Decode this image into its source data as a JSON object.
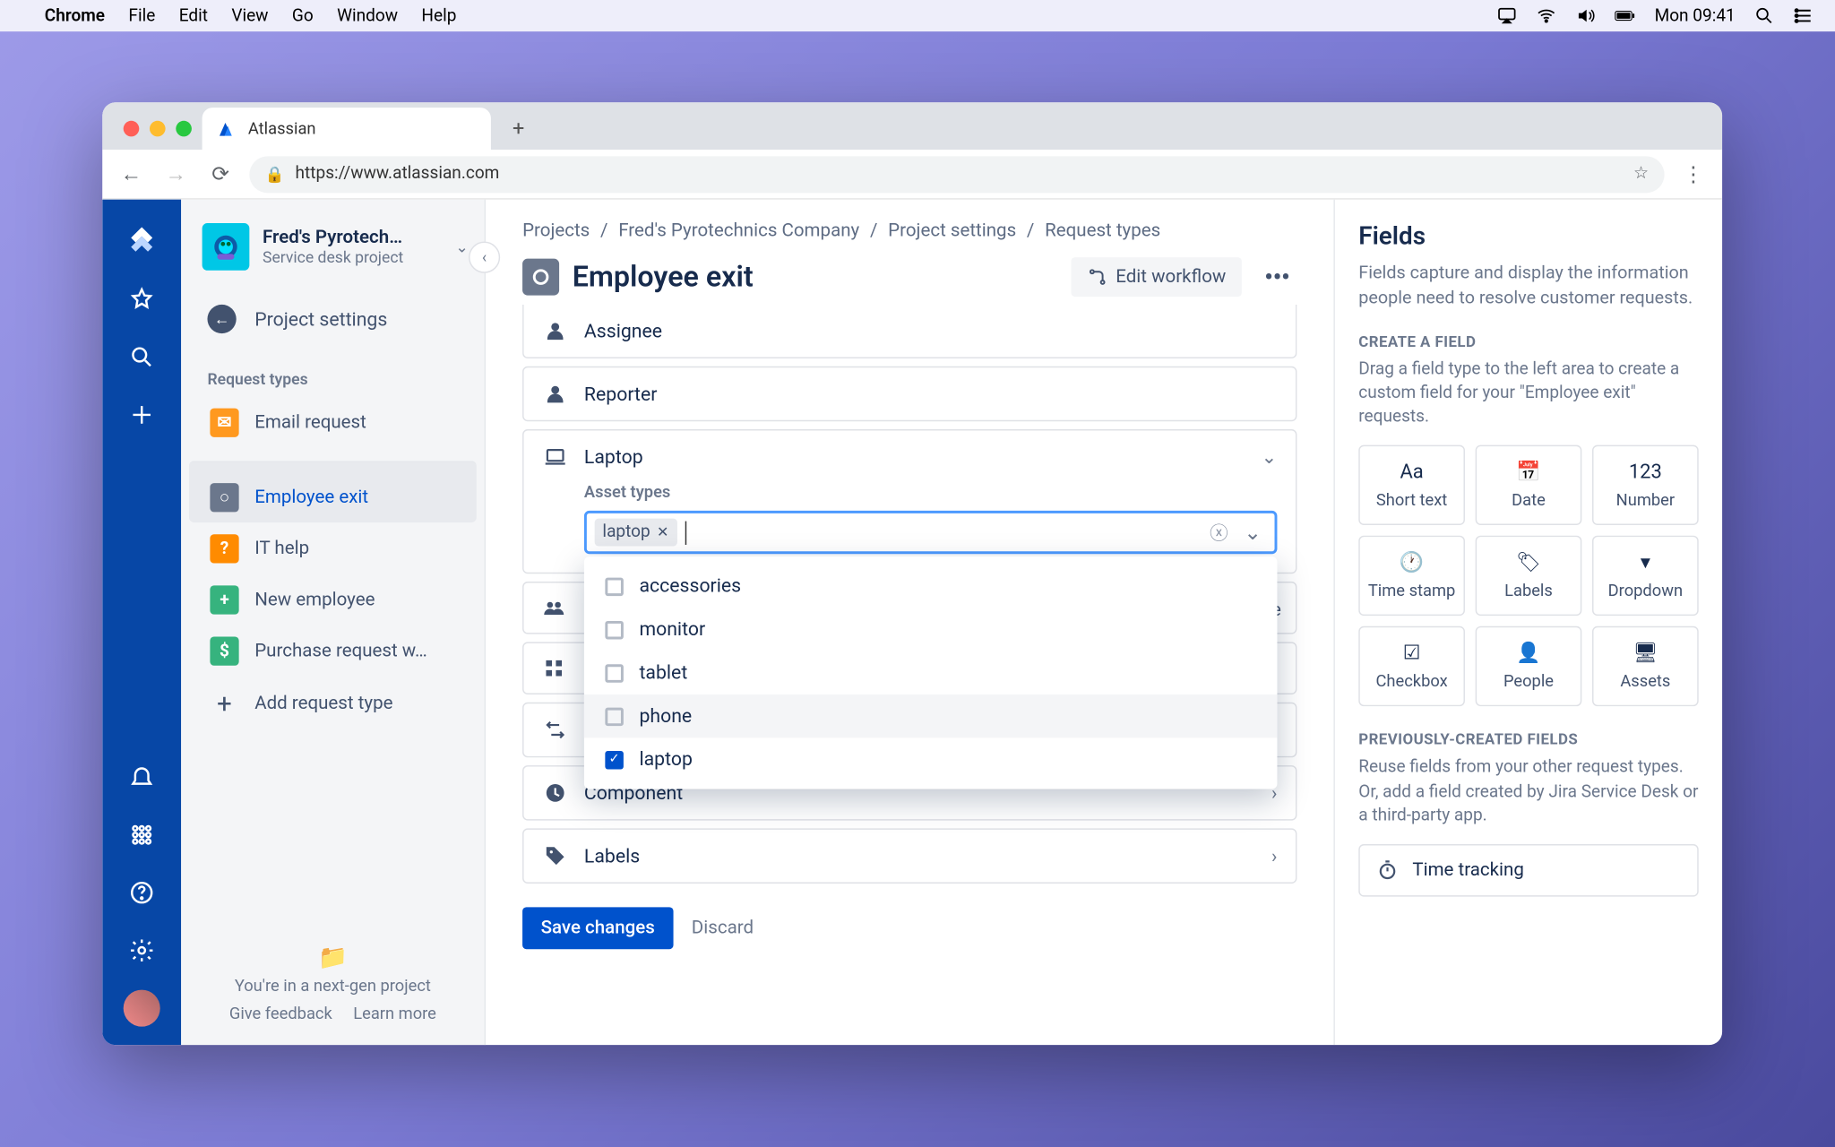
{
  "menubar": {
    "app": "Chrome",
    "items": [
      "File",
      "Edit",
      "View",
      "Go",
      "Window",
      "Help"
    ],
    "clock": "Mon 09:41"
  },
  "browser": {
    "tab_title": "Atlassian",
    "url": "https://www.atlassian.com"
  },
  "navrail": {
    "items": [
      "star",
      "search",
      "plus"
    ],
    "bottom": [
      "notify",
      "apps",
      "help",
      "settings"
    ]
  },
  "project": {
    "name": "Fred's Pyrotech…",
    "subtitle": "Service desk project",
    "back": "Project settings"
  },
  "request_types": {
    "heading": "Request types",
    "items": [
      {
        "label": "Email request",
        "color": "#ff991f",
        "glyph": "✉"
      },
      {
        "label": "Employee exit",
        "color": "#6b778c",
        "glyph": "○",
        "selected": true
      },
      {
        "label": "IT help",
        "color": "#ff8b00",
        "glyph": "?"
      },
      {
        "label": "New employee",
        "color": "#36b37e",
        "glyph": "+"
      },
      {
        "label": "Purchase request w…",
        "color": "#36b37e",
        "glyph": "$"
      }
    ],
    "add": "Add request type"
  },
  "sidebar_footer": {
    "msg": "You're in a next-gen project",
    "feedback": "Give feedback",
    "learn": "Learn more"
  },
  "breadcrumb": [
    "Projects",
    "Fred's Pyrotechnics Company",
    "Project settings",
    "Request types"
  ],
  "page": {
    "title": "Employee exit",
    "edit_workflow": "Edit workflow"
  },
  "form_fields": {
    "assignee": "Assignee",
    "reporter": "Reporter",
    "laptop": "Laptop",
    "asset_types_label": "Asset types",
    "selected_chip": "laptop",
    "dropdown": [
      {
        "label": "accessories",
        "checked": false
      },
      {
        "label": "monitor",
        "checked": false
      },
      {
        "label": "tablet",
        "checked": false
      },
      {
        "label": "phone",
        "checked": false,
        "hover": true
      },
      {
        "label": "laptop",
        "checked": true
      }
    ],
    "remove": "Remove",
    "component": "Component",
    "labels": "Labels"
  },
  "buttons": {
    "save": "Save changes",
    "discard": "Discard"
  },
  "right": {
    "title": "Fields",
    "desc": "Fields capture and display the information people need to resolve customer requests.",
    "create_head": "CREATE A FIELD",
    "create_desc": "Drag a field type to the left area to create a custom field for your \"Employee exit\" requests.",
    "types": [
      "Short text",
      "Date",
      "Number",
      "Time stamp",
      "Labels",
      "Dropdown",
      "Checkbox",
      "People",
      "Assets"
    ],
    "prev_head": "PREVIOUSLY-CREATED FIELDS",
    "prev_desc": "Reuse fields from your other request types. Or, add a field created by Jira Service Desk or a third-party app.",
    "time_tracking": "Time tracking"
  }
}
